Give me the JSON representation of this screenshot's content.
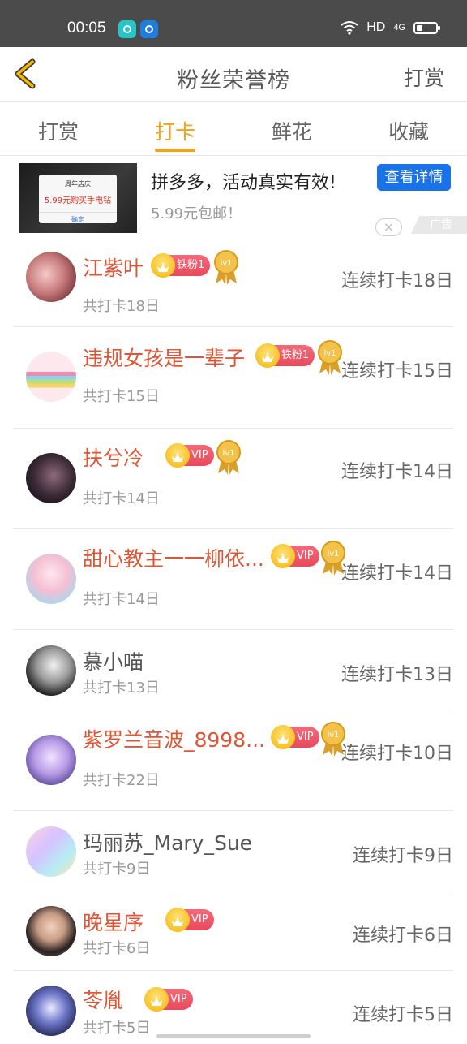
{
  "status_bar": {
    "time": "00:05",
    "network": "HD",
    "signal_label": "4G"
  },
  "header": {
    "title": "粉丝荣誉榜",
    "action_label": "打赏"
  },
  "tabs": [
    {
      "label": "打赏",
      "active": false
    },
    {
      "label": "打卡",
      "active": true
    },
    {
      "label": "鲜花",
      "active": false
    },
    {
      "label": "收藏",
      "active": false
    }
  ],
  "ad": {
    "title": "拼多多，活动真实有效!",
    "subtitle": "5.99元包邮！",
    "button_label": "查看详情",
    "tag": "广告",
    "image_card": {
      "title": "周年店庆",
      "main": "5.99元购买手电钻",
      "button": "确定"
    }
  },
  "accent_color": "#f2a317",
  "list": [
    {
      "name": "江紫叶",
      "badge": "铁粉1",
      "medal": "lv1",
      "streak": "连续打卡18日",
      "total": "共打卡18日",
      "highlight": true
    },
    {
      "name": "违规女孩是一辈子",
      "badge": "铁粉1",
      "medal": "lv1",
      "streak": "连续打卡15日",
      "total": "共打卡15日",
      "highlight": true
    },
    {
      "name": "扶兮冷",
      "badge": "VIP",
      "medal": "lv1",
      "streak": "连续打卡14日",
      "total": "共打卡14日",
      "highlight": true
    },
    {
      "name": "甜心教主一一柳依...",
      "badge": "VIP",
      "medal": "lv1",
      "streak": "连续打卡14日",
      "total": "共打卡14日",
      "highlight": true
    },
    {
      "name": "慕小喵",
      "badge": "",
      "medal": "",
      "streak": "连续打卡13日",
      "total": "共打卡13日",
      "highlight": false
    },
    {
      "name": "紫罗兰音波_8998...",
      "badge": "VIP",
      "medal": "lv1",
      "streak": "连续打卡10日",
      "total": "共打卡22日",
      "highlight": true
    },
    {
      "name": "玛丽苏_Mary_Sue",
      "badge": "",
      "medal": "",
      "streak": "连续打卡9日",
      "total": "共打卡9日",
      "highlight": false
    },
    {
      "name": "晚星序",
      "badge": "VIP",
      "medal": "",
      "streak": "连续打卡6日",
      "total": "共打卡6日",
      "highlight": true
    },
    {
      "name": "苓胤",
      "badge": "VIP",
      "medal": "",
      "streak": "连续打卡5日",
      "total": "共打卡5日",
      "highlight": true
    }
  ]
}
